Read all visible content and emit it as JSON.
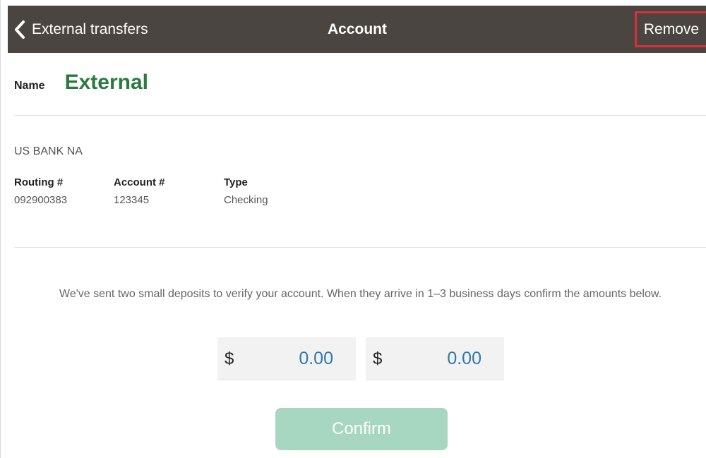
{
  "colors": {
    "navbar": "#4a4541",
    "name_accent": "#2a7a3f",
    "amount_text": "#2f78b0",
    "confirm_bg": "#a7d7c0",
    "remove_highlight": "#d9313a"
  },
  "nav": {
    "back_icon": "chevron-left-icon",
    "back_label": "External transfers",
    "title": "Account",
    "remove_label": "Remove"
  },
  "account": {
    "name_label": "Name",
    "name_value": "External",
    "bank_name": "US BANK NA",
    "routing_label": "Routing #",
    "routing_value": "092900383",
    "account_label": "Account #",
    "account_value": "123345",
    "type_label": "Type",
    "type_value": "Checking"
  },
  "verify": {
    "message": "We've sent two small deposits to verify your account. When they arrive in 1–3 business days confirm the amounts below.",
    "amounts": [
      {
        "currency": "$",
        "placeholder": "0.00"
      },
      {
        "currency": "$",
        "placeholder": "0.00"
      }
    ],
    "confirm_label": "Confirm"
  }
}
